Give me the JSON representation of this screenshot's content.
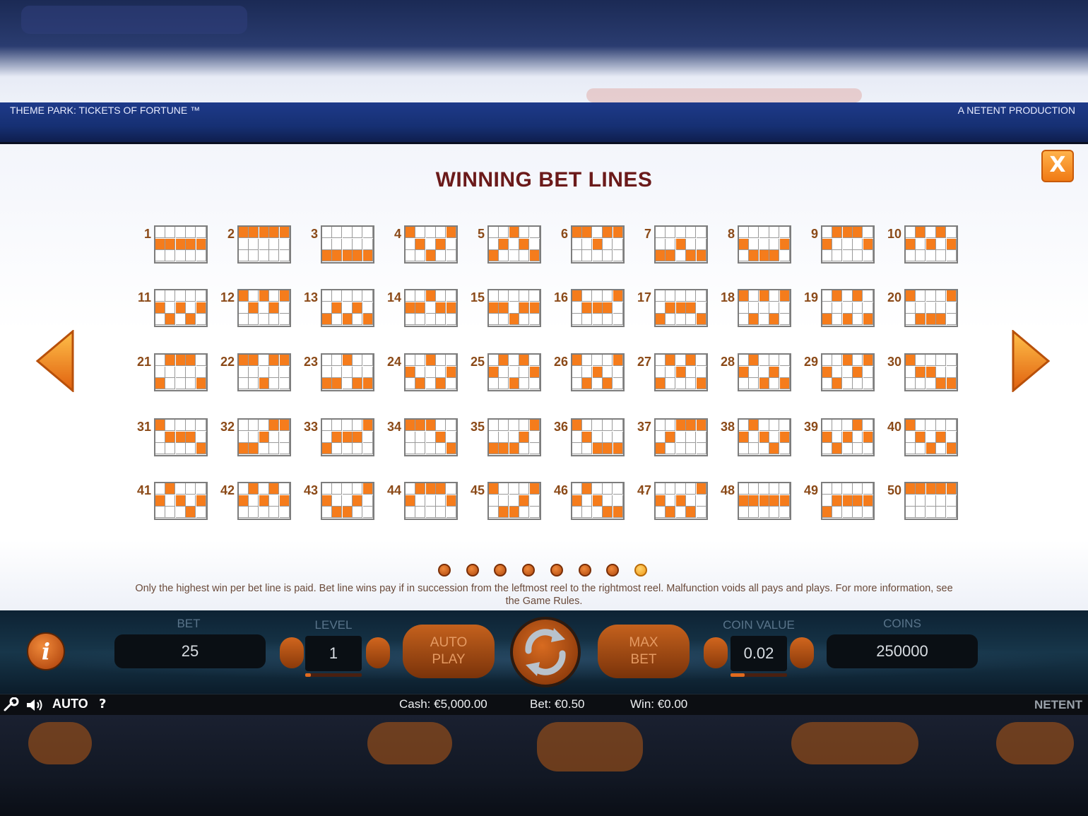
{
  "header": {
    "game_title": "THEME PARK: TICKETS OF FORTUNE ™",
    "producer": "A NETENT PRODUCTION"
  },
  "dialog": {
    "title": "WINNING BET LINES",
    "close_label": "X"
  },
  "pagination": {
    "total": 8,
    "active": 8
  },
  "disclaimer": "Only the highest win per bet line is paid. Bet line wins pay if in succession from the leftmost reel to the rightmost reel. Malfunction voids all pays and plays. For more information, see the Game Rules.",
  "paylines": [
    {
      "n": "1",
      "rows": [
        1,
        1,
        1,
        1,
        1
      ]
    },
    {
      "n": "2",
      "rows": [
        0,
        0,
        0,
        0,
        0
      ]
    },
    {
      "n": "3",
      "rows": [
        2,
        2,
        2,
        2,
        2
      ]
    },
    {
      "n": "4",
      "rows": [
        0,
        1,
        2,
        1,
        0
      ]
    },
    {
      "n": "5",
      "rows": [
        2,
        1,
        0,
        1,
        2
      ]
    },
    {
      "n": "6",
      "rows": [
        0,
        0,
        1,
        0,
        0
      ]
    },
    {
      "n": "7",
      "rows": [
        2,
        2,
        1,
        2,
        2
      ]
    },
    {
      "n": "8",
      "rows": [
        1,
        2,
        2,
        2,
        1
      ]
    },
    {
      "n": "9",
      "rows": [
        1,
        0,
        0,
        0,
        1
      ]
    },
    {
      "n": "10",
      "rows": [
        1,
        0,
        1,
        0,
        1
      ]
    },
    {
      "n": "11",
      "rows": [
        1,
        2,
        1,
        2,
        1
      ]
    },
    {
      "n": "12",
      "rows": [
        0,
        1,
        0,
        1,
        0
      ]
    },
    {
      "n": "13",
      "rows": [
        2,
        1,
        2,
        1,
        2
      ]
    },
    {
      "n": "14",
      "rows": [
        1,
        1,
        0,
        1,
        1
      ]
    },
    {
      "n": "15",
      "rows": [
        1,
        1,
        2,
        1,
        1
      ]
    },
    {
      "n": "16",
      "rows": [
        0,
        1,
        1,
        1,
        0
      ]
    },
    {
      "n": "17",
      "rows": [
        2,
        1,
        1,
        1,
        2
      ]
    },
    {
      "n": "18",
      "rows": [
        0,
        2,
        0,
        2,
        0
      ]
    },
    {
      "n": "19",
      "rows": [
        2,
        0,
        2,
        0,
        2
      ]
    },
    {
      "n": "20",
      "rows": [
        0,
        2,
        2,
        2,
        0
      ]
    },
    {
      "n": "21",
      "rows": [
        2,
        0,
        0,
        0,
        2
      ]
    },
    {
      "n": "22",
      "rows": [
        0,
        0,
        2,
        0,
        0
      ]
    },
    {
      "n": "23",
      "rows": [
        2,
        2,
        0,
        2,
        2
      ]
    },
    {
      "n": "24",
      "rows": [
        1,
        2,
        0,
        2,
        1
      ]
    },
    {
      "n": "25",
      "rows": [
        1,
        0,
        2,
        0,
        1
      ]
    },
    {
      "n": "26",
      "rows": [
        0,
        2,
        1,
        2,
        0
      ]
    },
    {
      "n": "27",
      "rows": [
        2,
        0,
        1,
        0,
        2
      ]
    },
    {
      "n": "28",
      "rows": [
        1,
        0,
        2,
        1,
        2
      ]
    },
    {
      "n": "29",
      "rows": [
        1,
        2,
        0,
        1,
        0
      ]
    },
    {
      "n": "30",
      "rows": [
        0,
        1,
        1,
        2,
        2
      ]
    },
    {
      "n": "31",
      "rows": [
        0,
        1,
        1,
        1,
        2
      ]
    },
    {
      "n": "32",
      "rows": [
        2,
        2,
        1,
        0,
        0
      ]
    },
    {
      "n": "33",
      "rows": [
        2,
        1,
        1,
        1,
        0
      ]
    },
    {
      "n": "34",
      "rows": [
        0,
        0,
        0,
        1,
        2
      ]
    },
    {
      "n": "35",
      "rows": [
        2,
        2,
        2,
        1,
        0
      ]
    },
    {
      "n": "36",
      "rows": [
        0,
        1,
        2,
        2,
        2
      ]
    },
    {
      "n": "37",
      "rows": [
        2,
        1,
        0,
        0,
        0
      ]
    },
    {
      "n": "38",
      "rows": [
        1,
        0,
        1,
        2,
        1
      ]
    },
    {
      "n": "39",
      "rows": [
        1,
        2,
        1,
        0,
        1
      ]
    },
    {
      "n": "40",
      "rows": [
        0,
        1,
        2,
        1,
        2
      ]
    },
    {
      "n": "41",
      "rows": [
        1,
        0,
        1,
        2,
        1
      ]
    },
    {
      "n": "42",
      "rows": [
        1,
        0,
        1,
        0,
        1
      ]
    },
    {
      "n": "43",
      "rows": [
        1,
        2,
        2,
        1,
        0
      ]
    },
    {
      "n": "44",
      "rows": [
        1,
        0,
        0,
        0,
        1
      ]
    },
    {
      "n": "45",
      "rows": [
        0,
        2,
        2,
        1,
        0
      ]
    },
    {
      "n": "46",
      "rows": [
        1,
        0,
        1,
        2,
        2
      ]
    },
    {
      "n": "47",
      "rows": [
        1,
        2,
        1,
        2,
        0
      ]
    },
    {
      "n": "48",
      "rows": [
        1,
        1,
        1,
        1,
        1
      ]
    },
    {
      "n": "49",
      "rows": [
        2,
        1,
        1,
        1,
        1
      ]
    },
    {
      "n": "50",
      "rows": [
        0,
        0,
        0,
        0,
        0
      ]
    }
  ],
  "controls": {
    "bet_label": "BET",
    "bet_value": "25",
    "level_label": "LEVEL",
    "level_value": "1",
    "level_progress": 0.1,
    "auto_play_label_1": "AUTO",
    "auto_play_label_2": "PLAY",
    "max_bet_label_1": "MAX",
    "max_bet_label_2": "BET",
    "coin_value_label": "COIN VALUE",
    "coin_value": "0.02",
    "coin_value_progress": 0.25,
    "coins_label": "COINS",
    "coins_value": "250000"
  },
  "status": {
    "auto_label": "AUTO",
    "help_label": "?",
    "cash": "Cash: €5,000.00",
    "bet": "Bet: €0.50",
    "win": "Win: €0.00",
    "brand": "NETENT"
  },
  "colors": {
    "accent": "#f57c1c",
    "heading": "#6b1a1a"
  }
}
